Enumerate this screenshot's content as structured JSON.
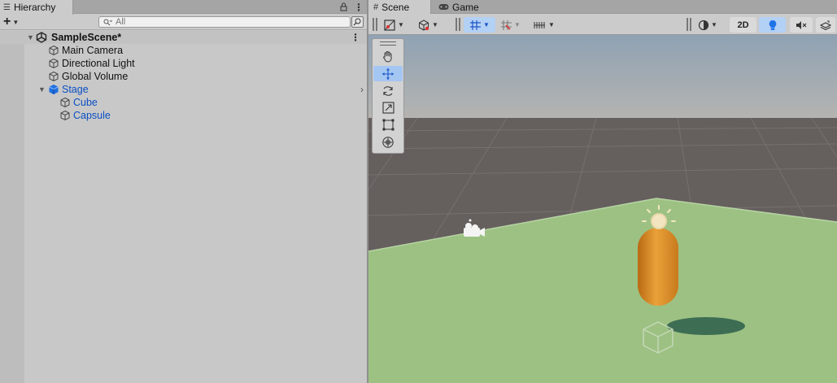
{
  "hierarchy": {
    "tab_label": "Hierarchy",
    "search_placeholder": "All",
    "add_symbol": "+",
    "scene_name": "SampleScene*",
    "items": [
      {
        "label": "Main Camera",
        "depth": 1,
        "prefab": false
      },
      {
        "label": "Directional Light",
        "depth": 1,
        "prefab": false
      },
      {
        "label": "Global Volume",
        "depth": 1,
        "prefab": false
      },
      {
        "label": "Stage",
        "depth": 1,
        "prefab": true
      },
      {
        "label": "Cube",
        "depth": 2,
        "prefab": true
      },
      {
        "label": "Capsule",
        "depth": 2,
        "prefab": true
      }
    ]
  },
  "scene_view": {
    "tabs": [
      {
        "label": "Scene",
        "icon": "grid-icon",
        "active": true
      },
      {
        "label": "Game",
        "icon": "gamepad-icon",
        "active": false
      }
    ],
    "toolbar": {
      "mode_2d_label": "2D"
    },
    "tools": [
      "hand-tool-icon",
      "move-tool-icon",
      "rotate-tool-icon",
      "scale-tool-icon",
      "rect-tool-icon",
      "transform-tool-icon"
    ],
    "active_tool": "move-tool-icon"
  },
  "colors": {
    "prefab_blue": "#0a4fc3",
    "ground_green": "#9dc183",
    "capsule_orange": "#e0901f",
    "sky_top": "#8fa2b3",
    "toggle_active": "#b3d0f5"
  }
}
